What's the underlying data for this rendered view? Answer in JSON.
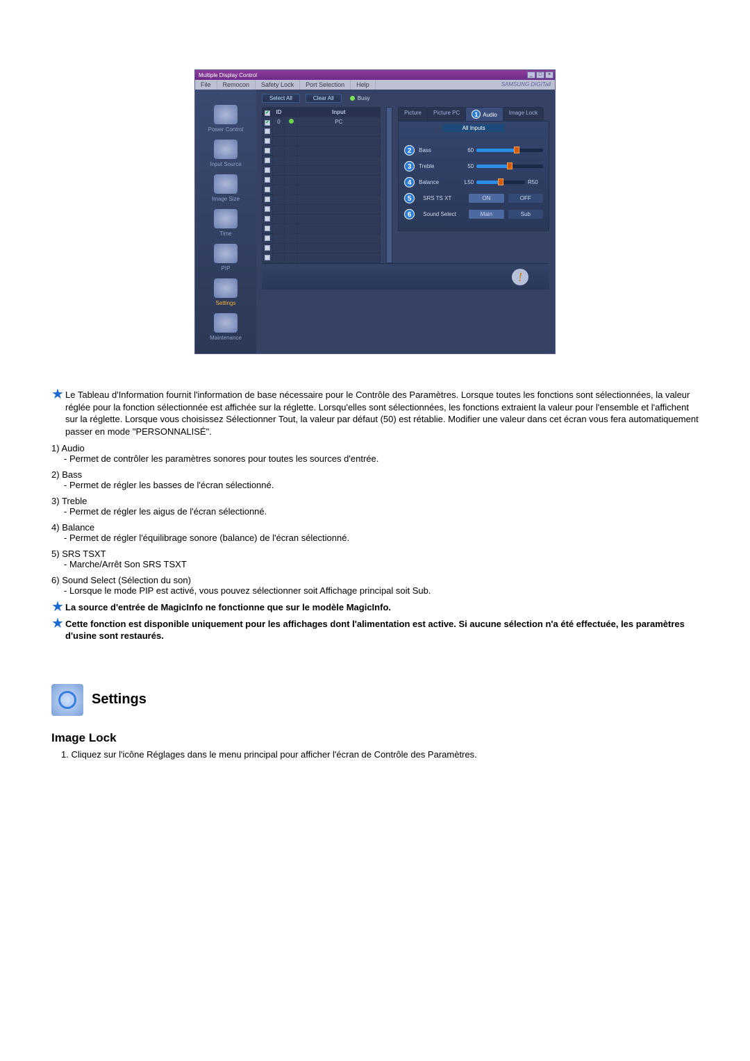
{
  "app": {
    "title": "Multiple Display Control",
    "brand": "SAMSUNG DIGITall",
    "menu": [
      "File",
      "Remocon",
      "Safety Lock",
      "Port Selection",
      "Help"
    ],
    "select_all": "Select All",
    "clear_all": "Clear All",
    "busy": "Busy",
    "grid_headers": {
      "id": "ID",
      "input": "Input"
    },
    "grid_row0": {
      "id": "0",
      "input": "PC"
    },
    "tabs": {
      "picture": "Picture",
      "picture_pc": "Picture PC",
      "audio": "Audio",
      "image_lock": "Image Lock"
    },
    "tab_ann": "1",
    "panel_head": "All Inputs",
    "sliders": {
      "bass": {
        "n": "2",
        "label": "Bass",
        "val": "60"
      },
      "treble": {
        "n": "3",
        "label": "Treble",
        "val": "50"
      },
      "balance": {
        "n": "4",
        "label": "Balance",
        "val": "L50",
        "end": "R50"
      }
    },
    "opts": {
      "srs": {
        "n": "5",
        "label": "SRS TS XT",
        "a": "ON",
        "b": "OFF"
      },
      "sound": {
        "n": "6",
        "label": "Sound Select",
        "a": "Main",
        "b": "Sub"
      }
    }
  },
  "sidebar": [
    {
      "label": "Power Control"
    },
    {
      "label": "Input Source"
    },
    {
      "label": "Image Size"
    },
    {
      "label": "Time"
    },
    {
      "label": "PIP"
    },
    {
      "label": "Settings"
    },
    {
      "label": "Maintenance"
    }
  ],
  "doc": {
    "star1": "Le Tableau d'Information fournit l'information de base nécessaire pour le Contrôle des Paramètres. Lorsque toutes les fonctions sont sélectionnées, la valeur réglée pour la fonction sélectionnée est affichée sur la réglette. Lorsqu'elles sont sélectionnées, les fonctions extraient la valeur pour l'ensemble et l'affichent sur la réglette. Lorsque vous choisissez Sélectionner Tout, la valeur par défaut (50) est rétablie. Modifier une valeur dans cet écran vous fera automatiquement passer en mode \"PERSONNALISÉ\".",
    "items": [
      {
        "num": "1)",
        "label": "Audio",
        "desc": "- Permet de contrôler les paramètres sonores pour toutes les sources d'entrée."
      },
      {
        "num": "2)",
        "label": "Bass",
        "desc": "- Permet de régler les basses de l'écran sélectionné."
      },
      {
        "num": "3)",
        "label": "Treble",
        "desc": "- Permet de régler les aigus de l'écran sélectionné."
      },
      {
        "num": "4)",
        "label": "Balance",
        "desc": "- Permet de régler l'équilibrage sonore (balance) de l'écran sélectionné."
      },
      {
        "num": "5)",
        "label": "SRS TSXT",
        "desc": "- Marche/Arrêt Son SRS TSXT"
      },
      {
        "num": "6)",
        "label": "Sound Select (Sélection du son)",
        "desc": "- Lorsque le mode PIP est activé, vous pouvez sélectionner soit Affichage principal soit Sub."
      }
    ],
    "star2": "La source d'entrée de MagicInfo ne fonctionne que sur le modèle MagicInfo.",
    "star3": "Cette fonction est disponible uniquement pour les affichages dont l'alimentation est active. Si aucune sélection n'a été effectuée, les paramètres d'usine sont restaurés.",
    "settings_heading": "Settings",
    "subheading": "Image Lock",
    "step1_num": "1.",
    "step1": "Cliquez sur l'icône Réglages dans le menu principal pour afficher l'écran de Contrôle des Paramètres."
  }
}
